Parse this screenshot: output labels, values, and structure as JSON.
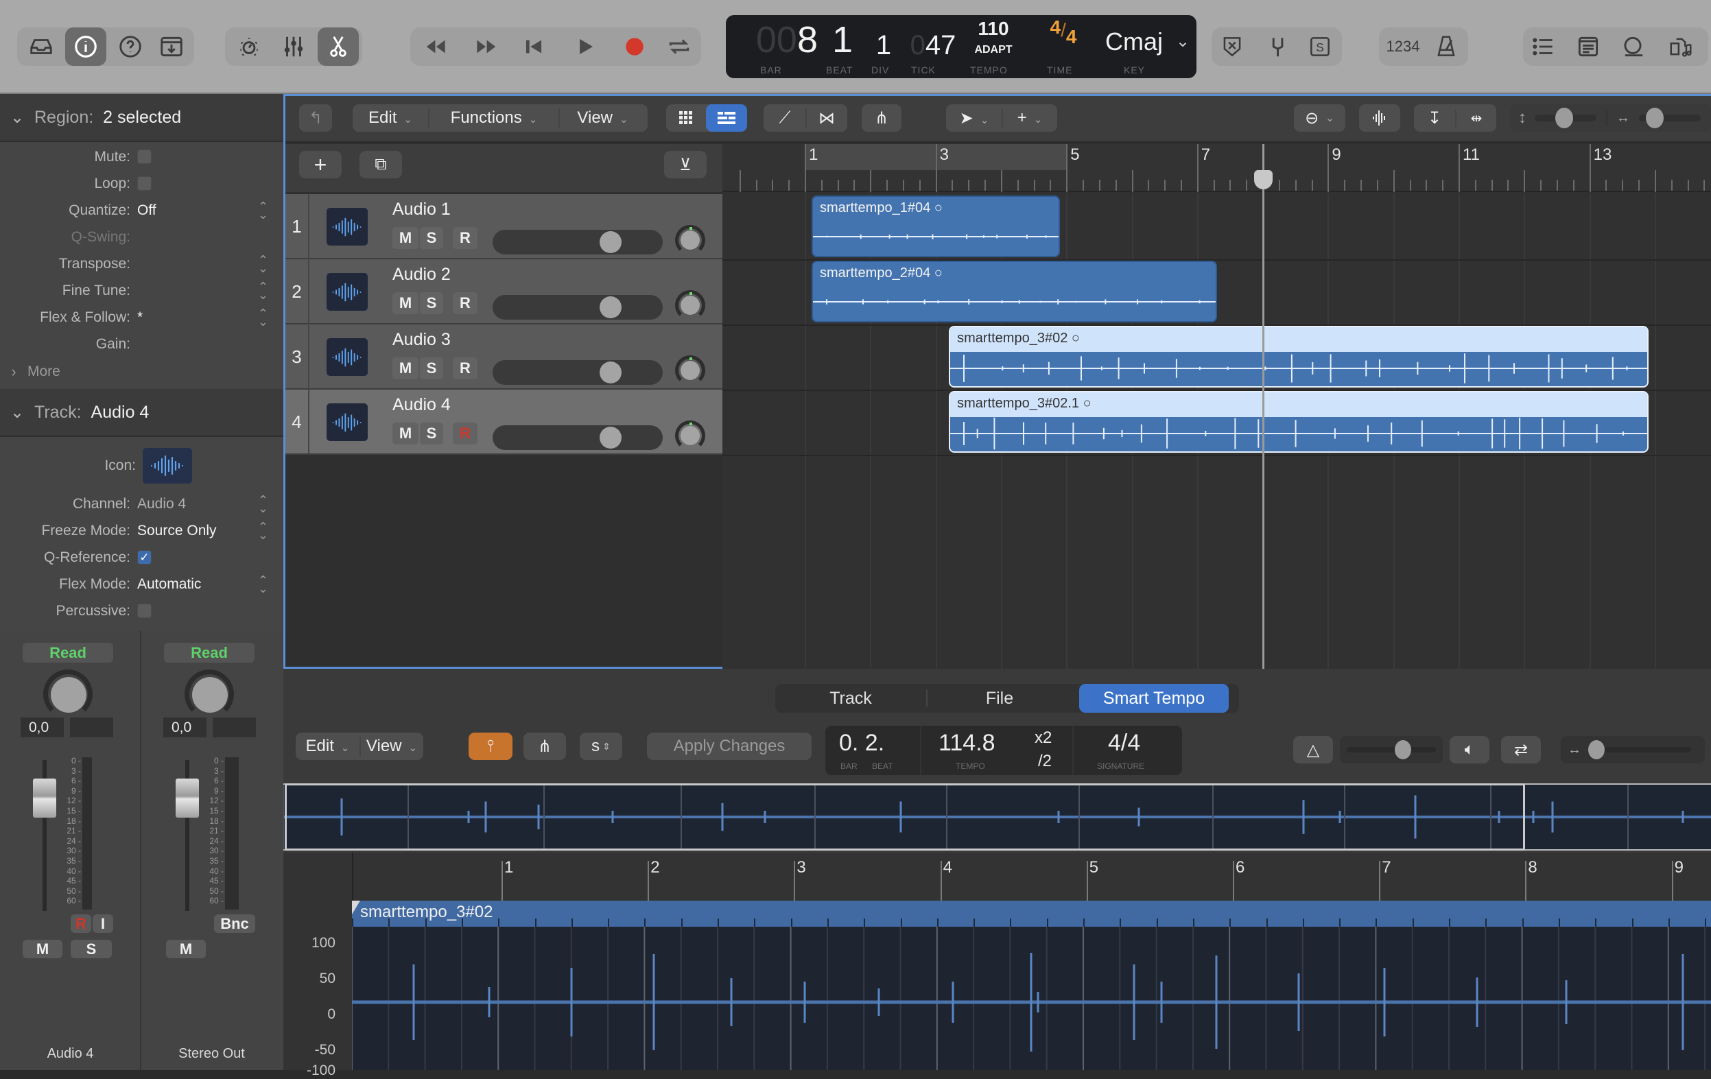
{
  "toolbar": {
    "left_group": [
      "library-icon",
      "info-icon",
      "help-icon",
      "download-icon"
    ],
    "mid_group": [
      "smart-controls-icon",
      "mixer-icon",
      "editors-icon"
    ],
    "transport": [
      "rewind-icon",
      "fast-forward-icon",
      "go-to-beginning-icon",
      "play-icon",
      "record-icon",
      "cycle-icon"
    ],
    "lcd": {
      "bar": "8",
      "bar_prefix": "00",
      "beat": "1",
      "div": "1",
      "tick_prefix": "0",
      "tick": "47",
      "tempo": "110",
      "tempo_mode": "ADAPT",
      "time_num": "4",
      "time_den": "4",
      "key": "Cmaj",
      "labels": {
        "bar": "BAR",
        "beat": "BEAT",
        "div": "DIV",
        "tick": "TICK",
        "tempo": "TEMPO",
        "time": "TIME",
        "key": "KEY"
      }
    },
    "right_group1": [
      "replace-icon",
      "tuner-icon",
      "solo-icon"
    ],
    "count_in": "1234",
    "right_group2": [
      "list-editors-icon",
      "note-pad-icon",
      "loop-browser-icon",
      "browsers-icon"
    ]
  },
  "inspector": {
    "region": {
      "label": "Region:",
      "value": "2 selected",
      "rows": [
        {
          "key": "Mute:",
          "type": "checkbox",
          "checked": false
        },
        {
          "key": "Loop:",
          "type": "checkbox",
          "checked": false
        },
        {
          "key": "Quantize:",
          "value": "Off",
          "stepper": true
        },
        {
          "key": "Q-Swing:",
          "value": "",
          "disabled": true
        },
        {
          "key": "Transpose:",
          "value": "",
          "stepper": true
        },
        {
          "key": "Fine Tune:",
          "value": "",
          "stepper": true
        },
        {
          "key": "Flex & Follow:",
          "value": "*",
          "stepper": true
        },
        {
          "key": "Gain:",
          "value": ""
        }
      ],
      "more": "More"
    },
    "track": {
      "label": "Track:",
      "value": "Audio 4",
      "icon_label": "Icon:",
      "rows": [
        {
          "key": "Channel:",
          "value": "Audio 4",
          "stepper": true,
          "dim": true
        },
        {
          "key": "Freeze Mode:",
          "value": "Source Only",
          "stepper": true
        },
        {
          "key": "Q-Reference:",
          "type": "checkbox",
          "checked": true
        },
        {
          "key": "Flex Mode:",
          "value": "Automatic",
          "stepper": true
        },
        {
          "key": "Percussive:",
          "type": "checkbox",
          "checked": false
        }
      ]
    },
    "strips": [
      {
        "automation": "Read",
        "value": "0,0",
        "buttons": [
          "R",
          "I",
          "M",
          "S"
        ],
        "name": "Audio 4"
      },
      {
        "automation": "Read",
        "value": "0,0",
        "buttons": [
          "Bnc",
          "M"
        ],
        "name": "Stereo Out"
      }
    ],
    "meter_scale": [
      "0",
      "3",
      "6",
      "9",
      "12",
      "15",
      "18",
      "21",
      "24",
      "30",
      "35",
      "40",
      "45",
      "50",
      "60"
    ]
  },
  "tracks_area": {
    "menus": [
      "Edit",
      "Functions",
      "View"
    ],
    "tracks": [
      {
        "num": "1",
        "name": "Audio 1",
        "m": "M",
        "s": "S",
        "r": "R",
        "rec_armed": false,
        "volume": 0.72
      },
      {
        "num": "2",
        "name": "Audio 2",
        "m": "M",
        "s": "S",
        "r": "R",
        "rec_armed": false,
        "volume": 0.72
      },
      {
        "num": "3",
        "name": "Audio 3",
        "m": "M",
        "s": "S",
        "r": "R",
        "rec_armed": false,
        "volume": 0.72
      },
      {
        "num": "4",
        "name": "Audio 4",
        "m": "M",
        "s": "S",
        "r": "R",
        "rec_armed": true,
        "volume": 0.72,
        "selected": true
      }
    ],
    "ruler_bars": [
      "1",
      "3",
      "5",
      "7",
      "9",
      "11",
      "13"
    ],
    "regions": [
      {
        "name": "smarttempo_1#04",
        "track": 1,
        "start_bar": 1,
        "end_bar": 4.8,
        "selected": false
      },
      {
        "name": "smarttempo_2#04",
        "track": 2,
        "start_bar": 1,
        "end_bar": 7.2,
        "selected": false
      },
      {
        "name": "smarttempo_3#02",
        "track": 3,
        "start_bar": 3.1,
        "end_bar": 13.8,
        "selected": true
      },
      {
        "name": "smarttempo_3#02.1",
        "track": 4,
        "start_bar": 3.1,
        "end_bar": 13.8,
        "selected": true
      }
    ],
    "playhead_bar": 8.0
  },
  "editor": {
    "tabs": [
      {
        "label": "Track"
      },
      {
        "label": "File"
      },
      {
        "label": "Smart Tempo",
        "active": true
      }
    ],
    "menus": [
      "Edit",
      "View"
    ],
    "s_label": "s",
    "apply_changes": "Apply Changes",
    "lcd": {
      "position": "0. 2.",
      "pos_labels": [
        "BAR",
        "BEAT"
      ],
      "tempo": "114.8",
      "tempo_label": "TEMPO",
      "x2": "x2",
      "half": "/2",
      "signature": "4/4",
      "signature_label": "SIGNATURE"
    },
    "ruler_bars": [
      "1",
      "2",
      "3",
      "4",
      "5",
      "6",
      "7",
      "8",
      "9"
    ],
    "region_name": "smarttempo_3#02",
    "y_axis": [
      "100",
      "50",
      "0",
      "-50",
      "-100"
    ]
  }
}
